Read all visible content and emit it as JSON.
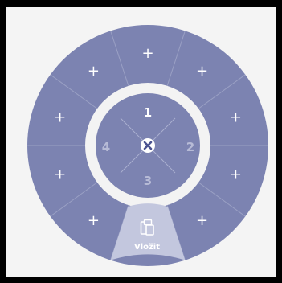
{
  "colors": {
    "ring": "#7c83b1",
    "ring_dark": "#6e75a6",
    "segment_line": "#9aa0c4",
    "gap": "#f3f3f3",
    "inner_disc": "#7c83b1",
    "active_wedge": "#c3c7de",
    "quad_num_active": "#ffffff",
    "quad_num_inactive": "#b7bbd6"
  },
  "outer_ring": {
    "slots": [
      {
        "label": "+",
        "icon": "plus-icon"
      },
      {
        "label": "+",
        "icon": "plus-icon"
      },
      {
        "label": "+",
        "icon": "plus-icon"
      },
      {
        "label": "+",
        "icon": "plus-icon"
      },
      {
        "label": "+",
        "icon": "plus-icon"
      },
      {
        "label": "+",
        "icon": "plus-icon"
      },
      {
        "label": "+",
        "icon": "plus-icon"
      },
      {
        "label": "+",
        "icon": "plus-icon"
      },
      {
        "label": "+",
        "icon": "plus-icon"
      }
    ],
    "active_slot": {
      "icon": "clipboard-icon",
      "label": "Vložit"
    }
  },
  "inner_dial": {
    "quadrants": [
      {
        "label": "1"
      },
      {
        "label": "2"
      },
      {
        "label": "3"
      },
      {
        "label": "4"
      }
    ],
    "center_icon": "close-icon"
  }
}
